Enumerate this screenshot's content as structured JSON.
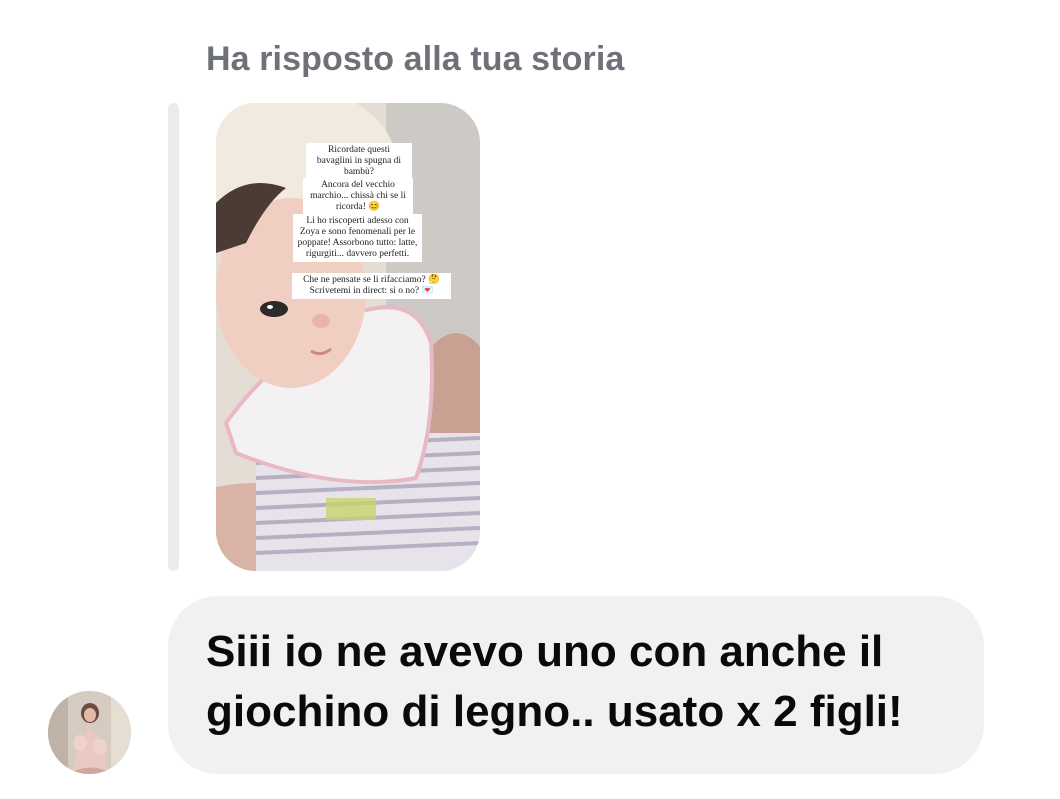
{
  "reply_header": "Ha risposto alla tua storia",
  "story": {
    "captions": [
      "Ricordate questi bavaglini in spugna di bambù?",
      "Ancora del vecchio marchio... chissà chi se li ricorda! 😊",
      "Li ho riscoperti adesso con Zoya e sono fenomenali per le poppate! Assorbono tutto: latte, rigurgiti... davvero perfetti.",
      "Che ne pensate se li rifacciamo? 🤔 Scrivetemi in direct: sì o no? 💌"
    ]
  },
  "message": {
    "text": "Siii io ne avevo uno con anche il giochino di legno.. usato x 2 figli!"
  },
  "colors": {
    "header_text": "#6e7278",
    "bubble_bg": "#f0f1f3",
    "reply_bar": "#ececee"
  }
}
